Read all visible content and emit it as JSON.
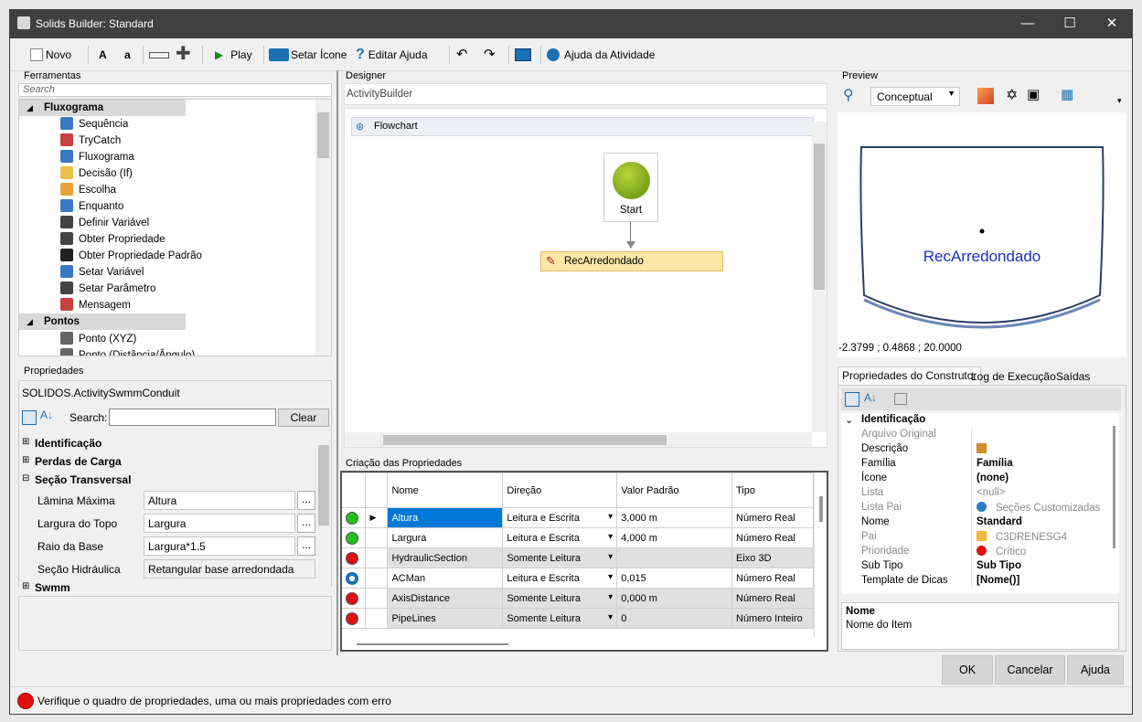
{
  "window": {
    "title": "Solids Builder: Standard"
  },
  "toolbar": {
    "novo": "Novo",
    "bold_a": "A",
    "small_a": "a",
    "play": "Play",
    "setar_icone": "Setar Ícone",
    "editar_ajuda": "Editar Ajuda",
    "ajuda_atividade": "Ajuda da Atividade"
  },
  "tools": {
    "panel_title": "Ferramentas",
    "search_placeholder": "Search",
    "groups": [
      {
        "label": "Fluxograma",
        "items": [
          "Sequência",
          "TryCatch",
          "Fluxograma",
          "Decisão (If)",
          "Escolha",
          "Enquanto",
          "Definir Variável",
          "Obter Propriedade",
          "Obter Propriedade Padrão",
          "Setar Variável",
          "Setar Parâmetro",
          "Mensagem"
        ]
      },
      {
        "label": "Pontos",
        "items": [
          "Ponto (XYZ)",
          "Ponto (Distância/Ângulo)"
        ]
      }
    ]
  },
  "properties": {
    "panel_title": "Propriedades",
    "object": "SOLIDOS.ActivitySwmmConduit",
    "search_label": "Search:",
    "clear": "Clear",
    "cat_identificacao": "Identificação",
    "cat_perdas": "Perdas de Carga",
    "cat_secao": "Seção Transversal",
    "cat_swmm": "Swmm",
    "rows": [
      {
        "label": "Lâmina Máxima",
        "value": "Altura"
      },
      {
        "label": "Largura do Topo",
        "value": "Largura"
      },
      {
        "label": "Raio da Base",
        "value": "Largura*1.5"
      },
      {
        "label": "Seção Hidráulica",
        "value": "Retangular base arredondada"
      }
    ]
  },
  "designer": {
    "panel_title": "Designer",
    "breadcrumb": "ActivityBuilder",
    "flowchart_label": "Flowchart",
    "start_label": "Start",
    "activity_label": "RecArredondado"
  },
  "criacao": {
    "panel_title": "Criação das Propriedades",
    "headers": [
      "Nome",
      "Direção",
      "Valor Padrão",
      "Tipo"
    ],
    "rows": [
      {
        "status": "green",
        "nome": "Altura",
        "direcao": "Leitura e Escrita",
        "valor": "3,000 m",
        "tipo": "Número Real",
        "selected": true
      },
      {
        "status": "green",
        "nome": "Largura",
        "direcao": "Leitura e Escrita",
        "valor": "4,000 m",
        "tipo": "Número Real"
      },
      {
        "status": "red",
        "nome": "HydraulicSection",
        "direcao": "Somente Leitura",
        "valor": "",
        "tipo": "Eixo 3D",
        "grey": true
      },
      {
        "status": "gear",
        "nome": "ACMan",
        "direcao": "Leitura e Escrita",
        "valor": "0,015",
        "tipo": "Número Real"
      },
      {
        "status": "red",
        "nome": "AxisDistance",
        "direcao": "Somente Leitura",
        "valor": "0,000 m",
        "tipo": "Número Real",
        "grey": true
      },
      {
        "status": "red",
        "nome": "PipeLines",
        "direcao": "Somente Leitura",
        "valor": "0",
        "tipo": "Número Inteiro",
        "grey": true
      }
    ],
    "status_colors": {
      "green": "#22c11f",
      "red": "#e01010"
    }
  },
  "preview": {
    "panel_title": "Preview",
    "mode": "Conceptual",
    "label": "RecArredondado",
    "coords": "-2.3799 ; 0.4868 ; 20.0000"
  },
  "builder": {
    "tabs": [
      "Propriedades do Construtor",
      "Log de Execução",
      "Saídas"
    ],
    "category": "Identificação",
    "rows": [
      {
        "name": "Arquivo Original",
        "value": "",
        "disabled": true
      },
      {
        "name": "Descrição",
        "value": "",
        "icon": "edit-icon"
      },
      {
        "name": "Família",
        "value": "Família",
        "bold": true
      },
      {
        "name": "Ícone",
        "value": "(none)",
        "bold": true
      },
      {
        "name": "Lista",
        "value": "<null>",
        "disabled": true
      },
      {
        "name": "Lista Pai",
        "value": "Seções Customizadas",
        "disabled": true,
        "icon": "gear-icon"
      },
      {
        "name": "Nome",
        "value": "Standard",
        "bold": true
      },
      {
        "name": "Pai",
        "value": "C3DRENESG4",
        "disabled": true,
        "icon": "folder-icon"
      },
      {
        "name": "Prioridade",
        "value": "Crítico",
        "disabled": true,
        "icon": "red-dot-icon"
      },
      {
        "name": "Sub Tipo",
        "value": "Sub Tipo",
        "bold": true
      },
      {
        "name": "Template de Dicas",
        "value": "[Nome()]",
        "bold": true
      }
    ],
    "desc_title": "Nome",
    "desc_text": "Nome do Item"
  },
  "buttons": {
    "ok": "OK",
    "cancelar": "Cancelar",
    "ajuda": "Ajuda"
  },
  "status": {
    "text": "Verifique o quadro de propriedades, uma ou mais propriedades com erro",
    "color": "#e01010"
  }
}
